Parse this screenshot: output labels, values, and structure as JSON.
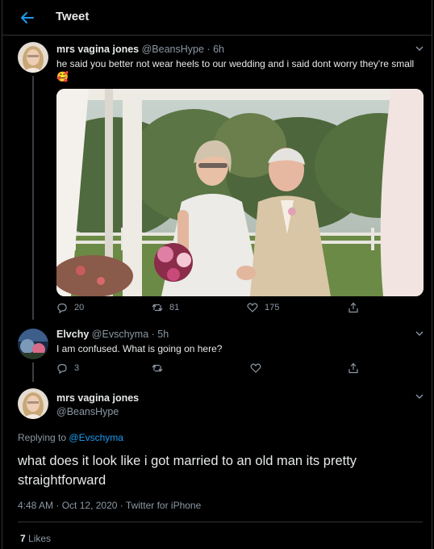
{
  "header": {
    "title": "Tweet"
  },
  "tweet1": {
    "name": "mrs vagina jones",
    "handle": "@BeansHype",
    "time": "6h",
    "text": "he said you better not wear heels to our wedding and i said dont worry they're small",
    "emoji": "🥰",
    "replies": "20",
    "retweets": "81",
    "likes": "175"
  },
  "tweet2": {
    "name": "Elvchy",
    "handle": "@Evschyma",
    "time": "5h",
    "text": "I am confused. What is going on here?",
    "replies": "3"
  },
  "main": {
    "name": "mrs vagina jones",
    "handle": "@BeansHype",
    "replying_prefix": "Replying to",
    "replying_handle": "@Evschyma",
    "text": "what does it look like i got married to an old man its pretty straightforward",
    "time": "4:48 AM",
    "date": "Oct 12, 2020",
    "client": "Twitter for iPhone",
    "like_count": "7",
    "like_label": "Likes"
  },
  "colors": {
    "accent": "#1d9bf0",
    "muted": "#8b98a5",
    "background": "#000000"
  }
}
